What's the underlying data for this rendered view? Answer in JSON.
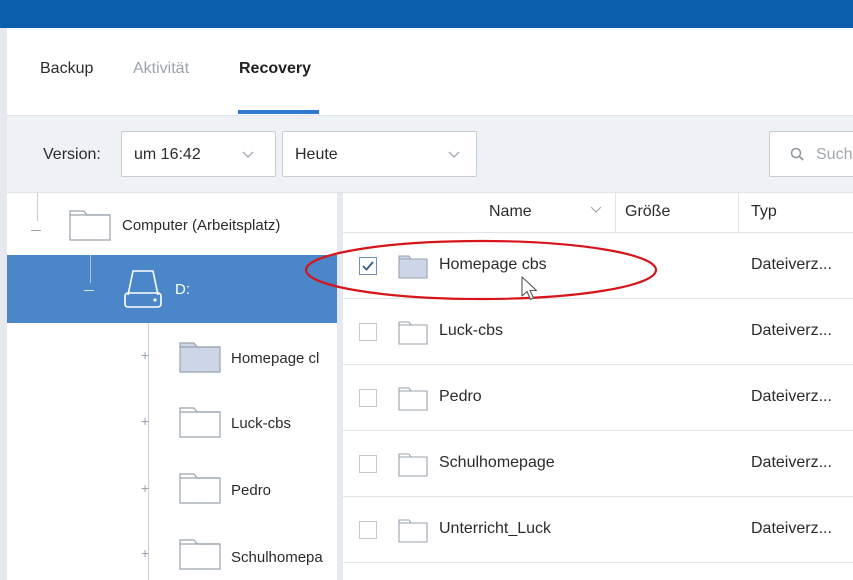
{
  "tabs": [
    {
      "label": "Backup",
      "state": "normal"
    },
    {
      "label": "Aktivität",
      "state": "disabled"
    },
    {
      "label": "Recovery",
      "state": "active"
    }
  ],
  "toolbar": {
    "version_label": "Version:",
    "time_value": "um 16:42",
    "day_value": "Heute",
    "search_placeholder": "Such"
  },
  "tree": {
    "root_label": "Computer (Arbeitsplatz)",
    "drive_label": "D:",
    "children": [
      {
        "label": "Homepage cl"
      },
      {
        "label": "Luck-cbs"
      },
      {
        "label": "Pedro"
      },
      {
        "label": "Schulhomepa"
      }
    ]
  },
  "list": {
    "columns": {
      "name": "Name",
      "size": "Größe",
      "type": "Typ"
    },
    "rows": [
      {
        "name": "Homepage cbs",
        "type": "Dateiverz...",
        "checked": true
      },
      {
        "name": "Luck-cbs",
        "type": "Dateiverz...",
        "checked": false
      },
      {
        "name": "Pedro",
        "type": "Dateiverz...",
        "checked": false
      },
      {
        "name": "Schulhomepage",
        "type": "Dateiverz...",
        "checked": false
      },
      {
        "name": "Unterricht_Luck",
        "type": "Dateiverz...",
        "checked": false
      }
    ]
  },
  "colors": {
    "topbar": "#0b5fad",
    "accent": "#2f7ad0",
    "selected_row": "#4a86c8",
    "annotation": "#d8141b"
  }
}
